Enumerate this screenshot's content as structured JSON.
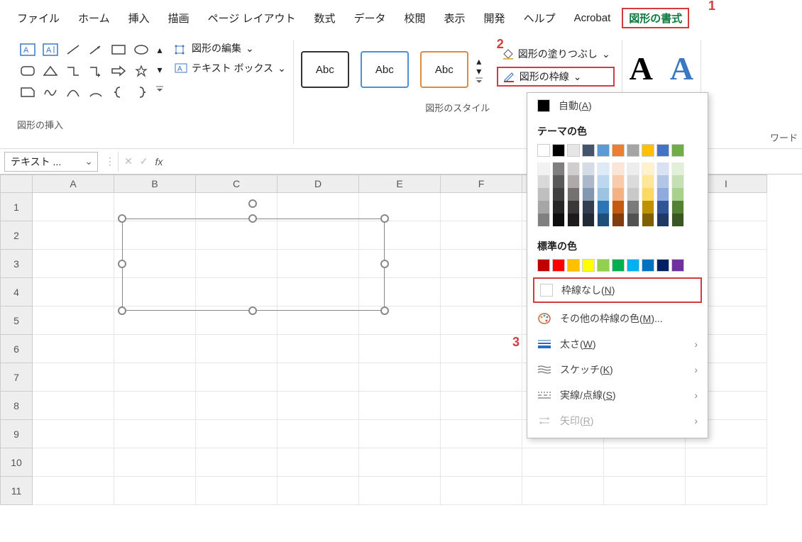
{
  "menu": {
    "items": [
      "ファイル",
      "ホーム",
      "挿入",
      "描画",
      "ページ レイアウト",
      "数式",
      "データ",
      "校閲",
      "表示",
      "開発",
      "ヘルプ",
      "Acrobat",
      "図形の書式"
    ]
  },
  "callouts": {
    "c1": "1",
    "c2": "2",
    "c3": "3"
  },
  "ribbon": {
    "shapes_group_label": "図形の挿入",
    "style_group_label": "図形のスタイル",
    "edit_shapes": "図形の編集",
    "text_box": "テキスト ボックス",
    "abc": "Abc",
    "shape_fill": "図形の塗りつぶし",
    "shape_outline": "図形の枠線",
    "wordart_label": "ワード"
  },
  "formula_bar": {
    "name_box": "テキスト ..."
  },
  "columns": [
    "A",
    "B",
    "C",
    "D",
    "E",
    "F",
    "",
    "",
    "I"
  ],
  "rows": [
    "1",
    "2",
    "3",
    "4",
    "5",
    "6",
    "7",
    "8",
    "9",
    "10",
    "11"
  ],
  "dropdown": {
    "auto": "自動(",
    "auto_key": "A",
    "theme_label": "テーマの色",
    "standard_label": "標準の色",
    "no_line": "枠線なし(",
    "no_line_key": "N",
    "more": "その他の枠線の色(",
    "more_key": "M",
    "more_suffix": ")...",
    "weight": "太さ(",
    "weight_key": "W",
    "sketch": "スケッチ(",
    "sketch_key": "K",
    "dashes": "実線/点線(",
    "dashes_key": "S",
    "arrows": "矢印(",
    "arrows_key": "R",
    "close_paren": ")",
    "theme_base": [
      "#FFFFFF",
      "#000000",
      "#E7E6E6",
      "#44546A",
      "#5B9BD5",
      "#ED7D31",
      "#A5A5A5",
      "#FFC000",
      "#4472C4",
      "#70AD47"
    ],
    "theme_shades": [
      [
        "#F2F2F2",
        "#D9D9D9",
        "#BFBFBF",
        "#A6A6A6",
        "#808080"
      ],
      [
        "#7F7F7F",
        "#595959",
        "#404040",
        "#262626",
        "#0D0D0D"
      ],
      [
        "#D0CECE",
        "#AEAAAA",
        "#757171",
        "#3B3838",
        "#1D1B1B"
      ],
      [
        "#D6DCE5",
        "#ADB9CA",
        "#8497B0",
        "#333F50",
        "#222A35"
      ],
      [
        "#DEEBF7",
        "#BDD7EE",
        "#9DC3E2",
        "#2E75B6",
        "#1F4E79"
      ],
      [
        "#FBE5D6",
        "#F8CBAD",
        "#F4B183",
        "#C55A11",
        "#843C0C"
      ],
      [
        "#EDEDED",
        "#DBDBDB",
        "#C9C9C9",
        "#7B7B7B",
        "#525252"
      ],
      [
        "#FFF2CC",
        "#FFE699",
        "#FFD966",
        "#BF9000",
        "#806000"
      ],
      [
        "#D9E1F2",
        "#B4C6E7",
        "#8FAADC",
        "#2F5597",
        "#203864"
      ],
      [
        "#E2F0D9",
        "#C5E0B4",
        "#A9D18E",
        "#548235",
        "#385723"
      ]
    ],
    "standard": [
      "#C00000",
      "#FF0000",
      "#FFC000",
      "#FFFF00",
      "#92D050",
      "#00B050",
      "#00B0F0",
      "#0070C0",
      "#002060",
      "#7030A0"
    ]
  }
}
